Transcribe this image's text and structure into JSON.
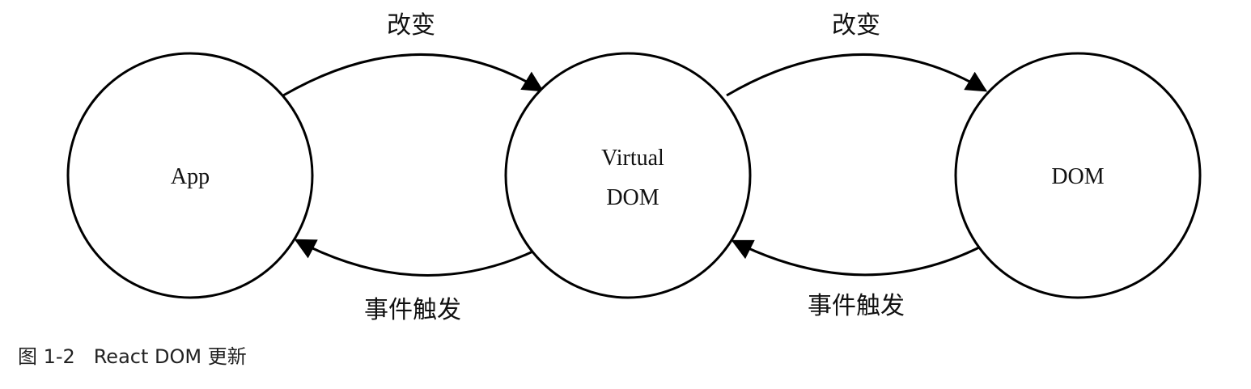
{
  "diagram": {
    "nodes": [
      {
        "id": "app",
        "lines": [
          "App"
        ]
      },
      {
        "id": "vdom",
        "lines": [
          "Virtual",
          "DOM"
        ]
      },
      {
        "id": "dom",
        "lines": [
          "DOM"
        ]
      }
    ],
    "edges": [
      {
        "from": "app",
        "to": "vdom",
        "label": "改变"
      },
      {
        "from": "vdom",
        "to": "dom",
        "label": "改变"
      },
      {
        "from": "vdom",
        "to": "app",
        "label": "事件触发"
      },
      {
        "from": "dom",
        "to": "vdom",
        "label": "事件触发"
      }
    ],
    "caption": "图 1-2   React DOM 更新"
  }
}
